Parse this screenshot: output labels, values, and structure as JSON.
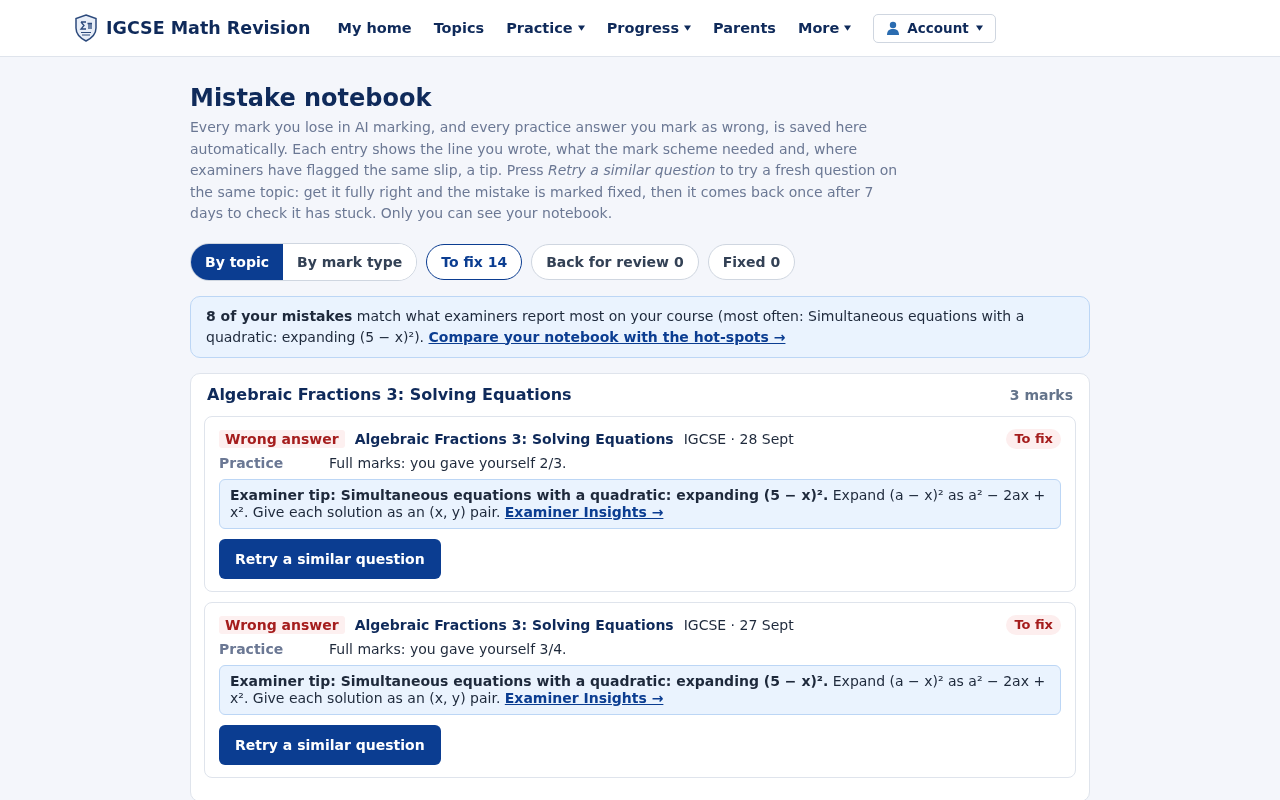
{
  "nav": {
    "brand": "IGCSE Math Revision",
    "items": [
      {
        "label": "My home",
        "kind": "link"
      },
      {
        "label": "Topics",
        "kind": "link"
      },
      {
        "label": "Practice",
        "kind": "dropdown"
      },
      {
        "label": "Progress",
        "kind": "dropdown"
      },
      {
        "label": "Parents",
        "kind": "link"
      },
      {
        "label": "More",
        "kind": "dropdown"
      }
    ],
    "account": {
      "label": "Account"
    }
  },
  "page": {
    "title": "Mistake notebook",
    "description": "Every mark you lose in AI marking, and every practice answer you mark as wrong, is saved here automatically. Each entry shows the line you wrote, what the mark scheme needed and, where examiners have flagged the same slip, a tip. Press *Retry a similar question* to try a fresh question on the same topic: get it fully right and the mistake is marked fixed, then it comes back once after 7 days to check it has stuck. Only you can see your notebook."
  },
  "views": [
    {
      "label": "By topic",
      "selected": true
    },
    {
      "label": "By mark type",
      "selected": false
    }
  ],
  "filters": [
    {
      "label": "To fix 14",
      "selected": true
    },
    {
      "label": "Back for review 0",
      "selected": false
    },
    {
      "label": "Fixed 0",
      "selected": false
    }
  ],
  "banner": {
    "text": "**8 of your mistakes** match what examiners report most on your course (most often: Simultaneous equations with a quadratic: expanding (5 − x)²).",
    "link": "Compare your notebook with the hot-spots →"
  },
  "groups": [
    {
      "title": "Algebraic Fractions 3: Solving Equations",
      "count": "3 marks",
      "entries": [
        {
          "type": "Wrong answer",
          "topic": "Algebraic Fractions 3: Solving Equations",
          "meta": "IGCSE · 28 Sept",
          "status": "To fix",
          "source": "Practice",
          "detail": "Full marks: you gave yourself 2/3.",
          "tip": "**Examiner tip: Simultaneous equations with a quadratic: expanding (5 − x)².** Expand (a − x)² as a² − 2ax + x². Give each solution as an (x, y) pair.",
          "tip_link": "Examiner Insights →",
          "button": "Retry a similar question"
        },
        {
          "type": "Wrong answer",
          "topic": "Algebraic Fractions 3: Solving Equations",
          "meta": "IGCSE · 27 Sept",
          "status": "To fix",
          "source": "Practice",
          "detail": "Full marks: you gave yourself 3/4.",
          "tip": "**Examiner tip: Simultaneous equations with a quadratic: expanding (5 − x)².** Expand (a − x)² as a² − 2ax + x². Give each solution as an (x, y) pair.",
          "tip_link": "Examiner Insights →",
          "button": "Retry a similar question"
        }
      ]
    }
  ]
}
